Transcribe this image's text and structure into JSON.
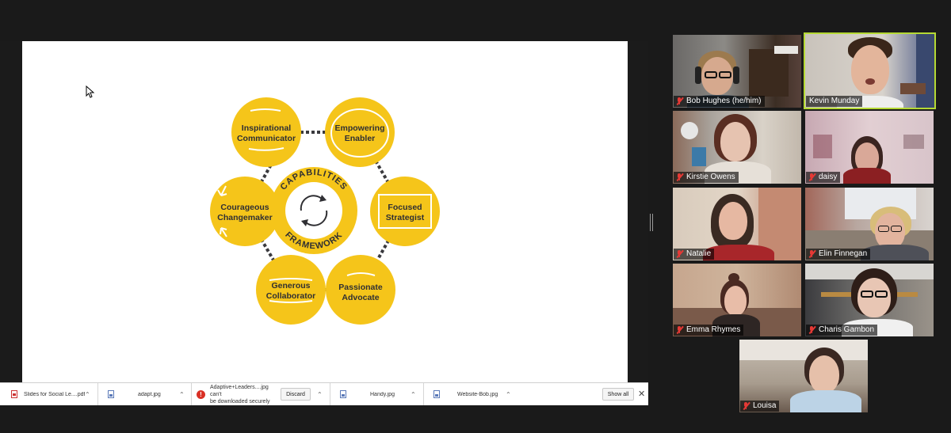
{
  "slide": {
    "center_top_text": "CAPABILITIES",
    "center_bottom_text": "FRAMEWORK",
    "nodes": [
      {
        "line1": "Inspirational",
        "line2": "Communicator"
      },
      {
        "line1": "Empowering",
        "line2": "Enabler"
      },
      {
        "line1": "Focused",
        "line2": "Strategist"
      },
      {
        "line1": "Passionate",
        "line2": "Advocate"
      },
      {
        "line1": "Generous",
        "line2": "Collaborator"
      },
      {
        "line1": "Courageous",
        "line2": "Changemaker"
      }
    ],
    "colors": {
      "yellow": "#f5c51a",
      "text": "#2f2f33"
    }
  },
  "downloads": {
    "items": [
      {
        "name": "Slides for Social Le....pdf",
        "icon": "pdf-file-icon"
      },
      {
        "name": "adapt.jpg",
        "icon": "image-file-icon"
      },
      {
        "name_line1": "Adaptive+Leaders....jpg can't",
        "name_line2": "be downloaded securely",
        "icon": "warning-icon",
        "action": "Discard"
      },
      {
        "name": "Handy.jpg",
        "icon": "image-file-icon"
      },
      {
        "name": "Website-Bob.jpg",
        "icon": "image-file-icon"
      }
    ],
    "show_all": "Show all"
  },
  "participants": [
    {
      "name": "Bob Hughes (he/him)",
      "muted": true
    },
    {
      "name": "Kevin Munday",
      "muted": false,
      "active_speaker": true
    },
    {
      "name": "Kirstie Owens",
      "muted": true
    },
    {
      "name": "daisy",
      "muted": true
    },
    {
      "name": "Natalie",
      "muted": true
    },
    {
      "name": "Elin Finnegan",
      "muted": true
    },
    {
      "name": "Emma Rhymes",
      "muted": true
    },
    {
      "name": "Charis Gambon",
      "muted": true
    },
    {
      "name": "Louisa",
      "muted": true
    }
  ],
  "colors": {
    "active_border": "#b5d934",
    "mic_muted": "#e53935",
    "background": "#1a1a1a"
  }
}
